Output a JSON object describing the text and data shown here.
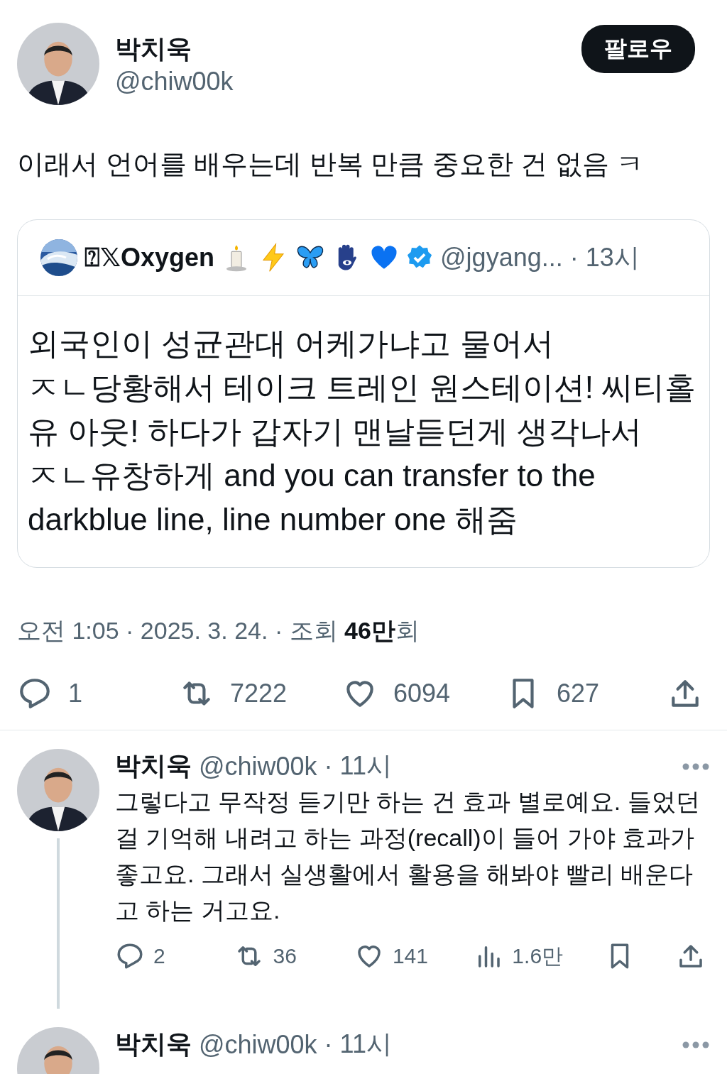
{
  "tweet": {
    "author": {
      "name": "박치욱",
      "handle": "@chiw00k"
    },
    "follow_button": "팔로우",
    "text": "이래서 언어를 배우는데 반복 만큼 중요한 건 없음 ㅋ",
    "quote": {
      "author": {
        "name": "⍰𝕏Oxygen",
        "verified": true,
        "handle": "@jgyang...",
        "time": "· 13시"
      },
      "lines": [
        "외국인이 성균관대 어케가냐고 물어서",
        "ㅈㄴ당황해서 테이크 트레인 원스테이션! 씨티홀",
        "유 아웃! 하다가 갑자기 맨날듣던게 생각나서",
        "ㅈㄴ유창하게 and you can transfer to the",
        "darkblue line, line number one 해줌"
      ]
    },
    "meta": {
      "time": "오전 1:05 · 2025. 3. 24. · 조회 ",
      "views": "46만",
      "views_unit": "회"
    },
    "actions": [
      {
        "kind": "reply",
        "count": "1"
      },
      {
        "kind": "retweet",
        "count": "7222"
      },
      {
        "kind": "like",
        "count": "6094"
      },
      {
        "kind": "bookmark",
        "count": "627"
      },
      {
        "kind": "share"
      }
    ]
  },
  "replies": [
    {
      "name": "박치욱",
      "handle": "@chiw00k",
      "time": "· 11시",
      "text": "그렇다고 무작정 듣기만 하는 건 효과 별로예요. 들었던 걸 기억해 내려고 하는 과정(recall)이 들어 가야 효과가 좋고요. 그래서 실생활에서 활용을 해봐야 빨리 배운다고 하는 거고요.",
      "actions": [
        {
          "kind": "reply",
          "count": "2"
        },
        {
          "kind": "retweet",
          "count": "36"
        },
        {
          "kind": "like",
          "count": "141"
        },
        {
          "kind": "views",
          "count": "1.6만"
        },
        {
          "kind": "bookmark"
        },
        {
          "kind": "share"
        }
      ]
    },
    {
      "name": "박치욱",
      "handle": "@chiw00k",
      "time": "· 11시"
    }
  ]
}
